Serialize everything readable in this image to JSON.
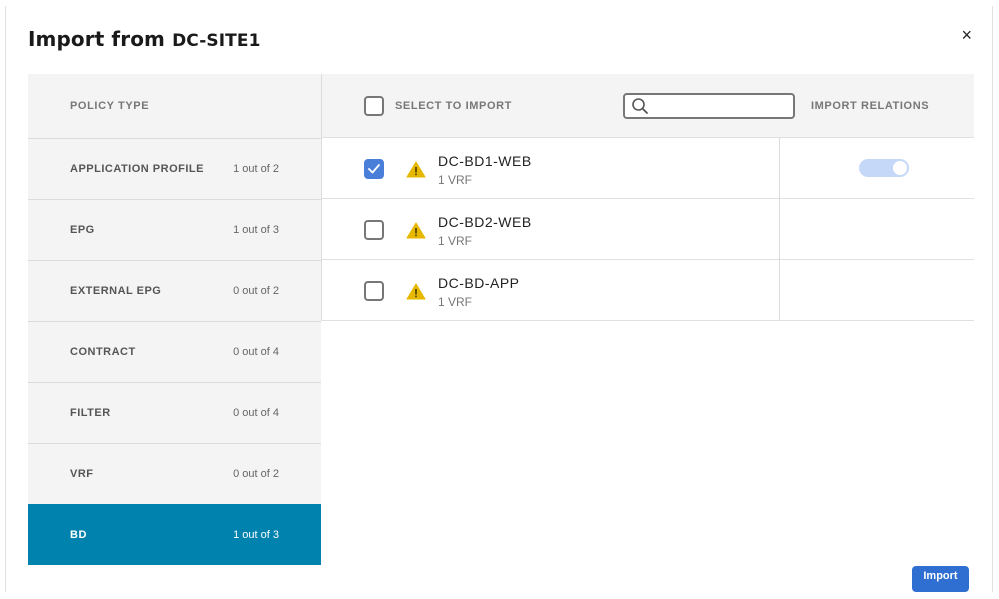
{
  "dialog": {
    "title_prefix": "Import from",
    "site": "DC-SITE1",
    "close_glyph": "×",
    "import_label": "Import"
  },
  "left": {
    "header": "POLICY TYPE",
    "items": [
      {
        "name": "APPLICATION PROFILE",
        "count": "1 out of 2",
        "active": false
      },
      {
        "name": "EPG",
        "count": "1 out of 3",
        "active": false
      },
      {
        "name": "EXTERNAL EPG",
        "count": "0 out of 2",
        "active": false
      },
      {
        "name": "CONTRACT",
        "count": "0 out of 4",
        "active": false
      },
      {
        "name": "FILTER",
        "count": "0 out of 4",
        "active": false
      },
      {
        "name": "VRF",
        "count": "0 out of 2",
        "active": false
      },
      {
        "name": "BD",
        "count": "1 out of 3",
        "active": true
      }
    ]
  },
  "right": {
    "select_label": "SELECT TO IMPORT",
    "search": {
      "placeholder": "",
      "value": ""
    },
    "relations_label": "IMPORT RELATIONS",
    "rows": [
      {
        "name": "DC-BD1-WEB",
        "sub": "1 VRF",
        "checked": true,
        "relations_toggle": true
      },
      {
        "name": "DC-BD2-WEB",
        "sub": "1 VRF",
        "checked": false,
        "relations_toggle": false
      },
      {
        "name": "DC-BD-APP",
        "sub": "1 VRF",
        "checked": false,
        "relations_toggle": false
      }
    ]
  },
  "colors": {
    "active_row": "#0082ae",
    "checkbox_checked": "#4a7fd9",
    "warning": "#e6b800",
    "toggle_track": "#c5d8f8",
    "import_button": "#2f6fd1"
  },
  "icons": [
    "close-icon",
    "search-icon",
    "checkmark-icon",
    "warning-icon"
  ]
}
